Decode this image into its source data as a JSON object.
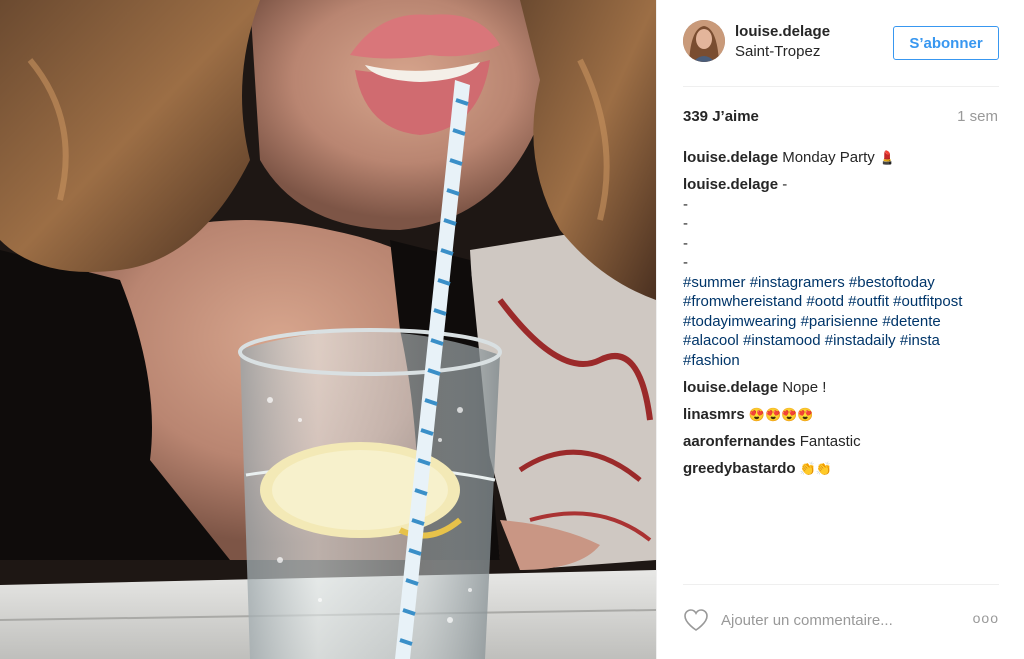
{
  "post": {
    "username": "louise.delage",
    "location": "Saint-Tropez",
    "follow_label": "S’abonner",
    "likes": "339 J’aime",
    "time_ago": "1 sem"
  },
  "comments": [
    {
      "user": "louise.delage",
      "text": "Monday Party",
      "emoji": "💄"
    },
    {
      "user": "louise.delage",
      "text": "-",
      "dashes": [
        "-",
        "-",
        "-",
        "-"
      ],
      "hashtags": [
        "#summer",
        "#instagramers",
        "#bestoftoday",
        "#fromwhereistand",
        "#ootd",
        "#outfit",
        "#outfitpost",
        "#todayimwearing",
        "#parisienne",
        "#detente",
        "#alacool",
        "#instamood",
        "#instadaily",
        "#insta",
        "#fashion"
      ]
    },
    {
      "user": "louise.delage",
      "text": "Nope !"
    },
    {
      "user": "linasmrs",
      "text": "😍😍😍😍"
    },
    {
      "user": "aaronfernandes",
      "text": "Fantastic"
    },
    {
      "user": "greedybastardo",
      "text": "👏👏"
    }
  ],
  "add_comment": {
    "placeholder": "Ajouter un commentaire...",
    "more_label": "ooo"
  },
  "icons": {
    "heart": "heart-icon",
    "more": "more-options-icon"
  },
  "colors": {
    "accent": "#3897f0",
    "hashtag": "#003569",
    "muted": "#999999"
  }
}
